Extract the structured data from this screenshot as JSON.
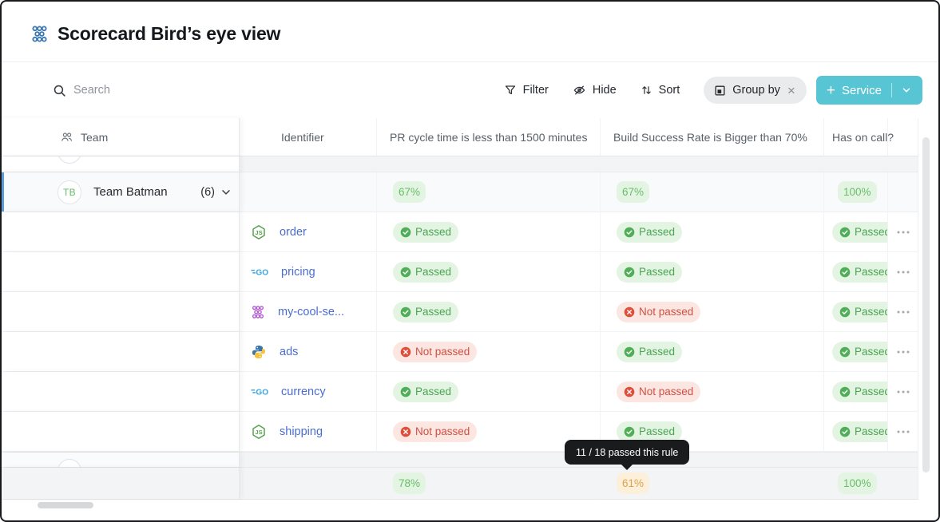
{
  "header": {
    "title": "Scorecard Bird’s eye view",
    "title_icon": "cluster-icon"
  },
  "toolbar": {
    "search_placeholder": "Search",
    "filter_label": "Filter",
    "hide_label": "Hide",
    "sort_label": "Sort",
    "group_by_label": "Group by",
    "add_button_label": "Service"
  },
  "table": {
    "columns": {
      "team": "Team",
      "identifier": "Identifier",
      "pr_rule": "PR cycle time is less than 1500 minutes",
      "build_rule": "Build Success Rate is Bigger than 70%",
      "oncall_rule": "Has on call?"
    },
    "group": {
      "avatar_initials": "TB",
      "name": "Team Batman",
      "count": "(6)",
      "summary": {
        "pr": "67%",
        "build": "67%",
        "oncall": "100%"
      }
    },
    "rows": [
      {
        "icon": "nodejs-icon",
        "identifier": "order",
        "pr": "Passed",
        "build": "Passed",
        "oncall": "Passed"
      },
      {
        "icon": "go-icon",
        "identifier": "pricing",
        "pr": "Passed",
        "build": "Passed",
        "oncall": "Passed"
      },
      {
        "icon": "cluster-icon",
        "identifier": "my-cool-se...",
        "pr": "Passed",
        "build": "Not passed",
        "oncall": "Passed"
      },
      {
        "icon": "python-icon",
        "identifier": "ads",
        "pr": "Not passed",
        "build": "Passed",
        "oncall": "Passed"
      },
      {
        "icon": "go-icon",
        "identifier": "currency",
        "pr": "Passed",
        "build": "Not passed",
        "oncall": "Passed"
      },
      {
        "icon": "nodejs-icon",
        "identifier": "shipping",
        "pr": "Not passed",
        "build": "Passed",
        "oncall": "Passed"
      }
    ],
    "bottom_summary": {
      "pr": "78%",
      "build": "61%",
      "oncall": "100%"
    }
  },
  "tooltip": {
    "text": "11 / 18 passed this rule"
  },
  "colors": {
    "accent_teal": "#58c5d5",
    "pass_green": "#4aa553",
    "fail_red": "#d14f41",
    "warn_orange": "#dda24b",
    "link_blue": "#4a6cd4",
    "selected_bar_blue": "#5e9ad6",
    "title_icon_blue": "#3c78b2",
    "cluster_purple": "#b464ce"
  }
}
